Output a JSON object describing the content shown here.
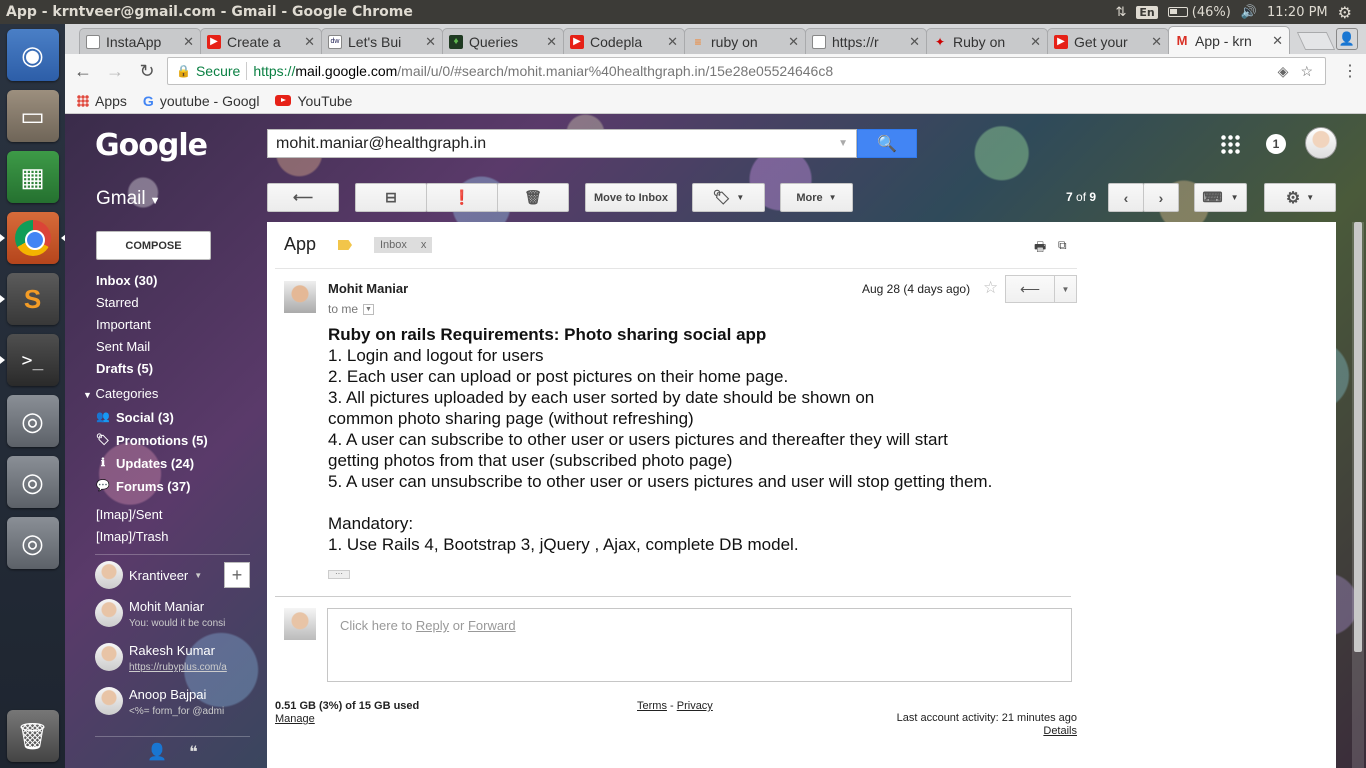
{
  "system": {
    "window_title": "App - krntveer@gmail.com - Gmail - Google Chrome",
    "lang": "En",
    "battery": "(46%)",
    "clock": "11:20 PM"
  },
  "tabs": [
    {
      "label": "InstaApp",
      "favicon": "page-icon"
    },
    {
      "label": "Create a",
      "favicon": "youtube-icon"
    },
    {
      "label": "Let's Bui",
      "favicon": "dw-icon"
    },
    {
      "label": "Queries",
      "favicon": "mongodb-icon"
    },
    {
      "label": "Codepla",
      "favicon": "youtube-icon"
    },
    {
      "label": "ruby on",
      "favicon": "stackoverflow-icon"
    },
    {
      "label": "https://r",
      "favicon": "page-icon"
    },
    {
      "label": "Ruby on",
      "favicon": "rails-icon"
    },
    {
      "label": "Get your",
      "favicon": "youtube-icon"
    },
    {
      "label": "App - krn",
      "favicon": "gmail-icon",
      "active": true
    }
  ],
  "omnibox": {
    "secure": "Secure",
    "proto": "https://",
    "host": "mail.google.com",
    "path": "/mail/u/0/#search/mohit.maniar%40healthgraph.in/15e28e05524646c8"
  },
  "bookmarks": {
    "apps": "Apps",
    "youtube_google": "youtube - Googl",
    "youtube": "YouTube"
  },
  "gmail": {
    "logo": "Google",
    "search_value": "mohit.maniar@healthgraph.in",
    "notif_count": "1",
    "label": "Gmail",
    "compose": "COMPOSE",
    "move_to_inbox": "Move to Inbox",
    "more": "More",
    "pager_current": "7",
    "pager_of": "of",
    "pager_total": "9",
    "nav": [
      {
        "label": "Inbox (30)",
        "bold": true
      },
      {
        "label": "Starred"
      },
      {
        "label": "Important"
      },
      {
        "label": "Sent Mail"
      },
      {
        "label": "Drafts (5)",
        "bold": true
      }
    ],
    "categories_label": "Categories",
    "categories": [
      {
        "label": "Social (3)",
        "icon": "people-icon"
      },
      {
        "label": "Promotions (5)",
        "icon": "tag-icon"
      },
      {
        "label": "Updates (24)",
        "icon": "info-icon"
      },
      {
        "label": "Forums (37)",
        "icon": "forum-icon"
      }
    ],
    "imap": [
      "[Imap]/Sent",
      "[Imap]/Trash"
    ],
    "hangouts": {
      "me": "Krantiveer",
      "contacts": [
        {
          "name": "Mohit Maniar",
          "msg": "You: would it be consi"
        },
        {
          "name": "Rakesh Kumar",
          "msg": "https://rubyplus.com/a"
        },
        {
          "name": "Anoop Bajpai",
          "msg": "<%= form_for @admi"
        }
      ]
    }
  },
  "message": {
    "subject": "App",
    "label_chip": "Inbox",
    "label_chip_close": "x",
    "sender": "Mohit Maniar",
    "to": "to me",
    "date": "Aug 28 (4 days ago)",
    "body_title": "Ruby on rails Requirements: Photo sharing social app",
    "body_lines": [
      "1. Login and logout for users",
      "2. Each user can upload or post pictures on their home page.",
      "3. All pictures uploaded by each user sorted by date should be shown on",
      "common photo sharing page (without refreshing)",
      "4. A user can subscribe to other user or users pictures and thereafter they will start",
      "getting photos from that user (subscribed photo page)",
      "5. A user can unsubscribe to other user or users pictures and user will stop getting them.",
      "",
      "Mandatory:",
      "1. Use Rails 4, Bootstrap 3, jQuery , Ajax, complete DB model."
    ],
    "reply_prefix": "Click here to",
    "reply_link": "Reply",
    "reply_or": "or",
    "forward_link": "Forward"
  },
  "footer": {
    "storage": "0.51 GB (3%) of 15 GB used",
    "manage": "Manage",
    "terms": "Terms",
    "dash": "-",
    "privacy": "Privacy",
    "activity": "Last account activity: 21 minutes ago",
    "details": "Details"
  }
}
